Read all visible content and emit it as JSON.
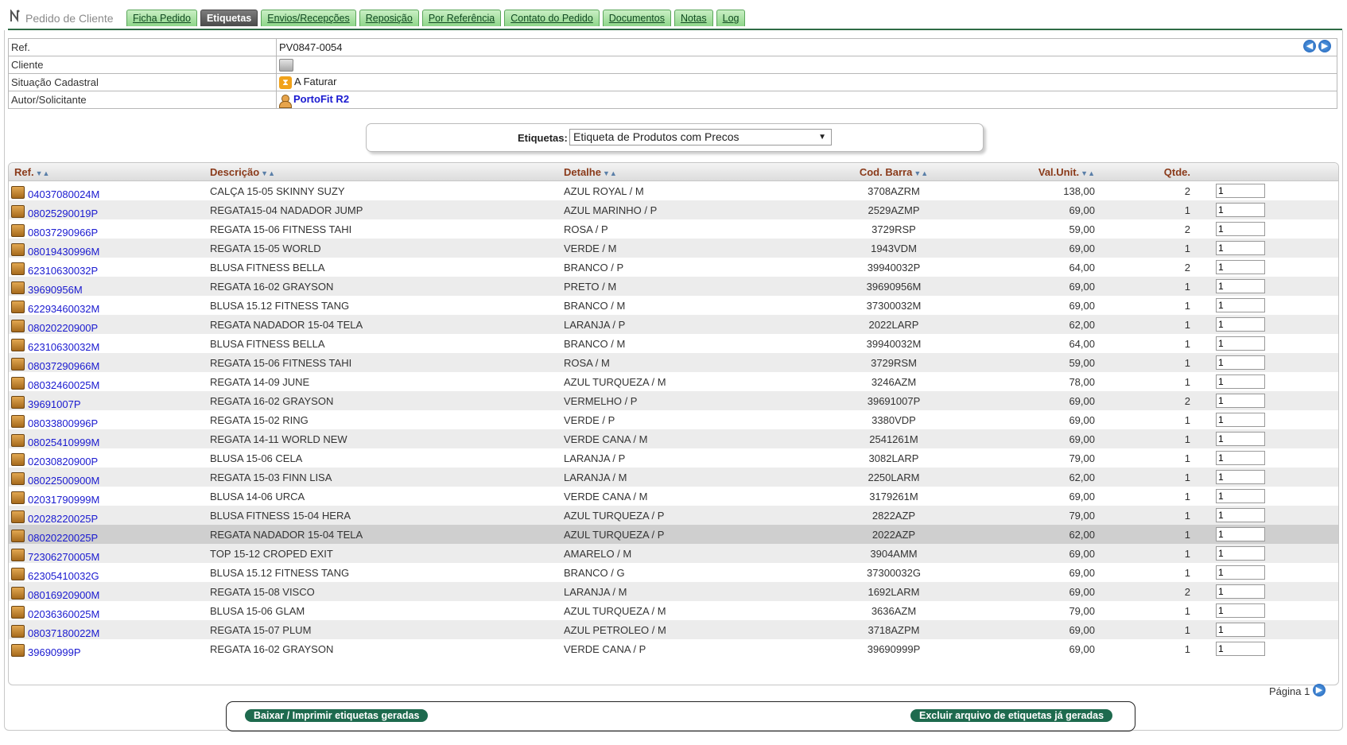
{
  "app": {
    "title": "Pedido de Cliente"
  },
  "tabs": [
    {
      "label": "Ficha Pedido",
      "active": false
    },
    {
      "label": "Etiquetas",
      "active": true
    },
    {
      "label": "Envios/Recepções",
      "active": false
    },
    {
      "label": "Reposição",
      "active": false
    },
    {
      "label": "Por Referência",
      "active": false
    },
    {
      "label": "Contato do Pedido",
      "active": false
    },
    {
      "label": "Documentos",
      "active": false
    },
    {
      "label": "Notas",
      "active": false
    },
    {
      "label": "Log",
      "active": false
    }
  ],
  "info": {
    "ref_label": "Ref.",
    "ref_value": "PV0847-0054",
    "client_label": "Cliente",
    "status_label": "Situação Cadastral",
    "status_value": "A Faturar",
    "author_label": "Autor/Solicitante",
    "author_value": "PortoFit R2"
  },
  "selector": {
    "label": "Etiquetas:",
    "value": "Etiqueta de Produtos com Precos"
  },
  "grid": {
    "headers": {
      "ref": "Ref.",
      "desc": "Descrição",
      "det": "Detalhe",
      "bar": "Cod. Barra",
      "val": "Val.Unit.",
      "qt": "Qtde."
    },
    "rows": [
      {
        "ref": "04037080024M",
        "desc": "CALÇA 15-05 SKINNY SUZY",
        "det": "AZUL ROYAL / M",
        "bar": "3708AZRM",
        "val": "138,00",
        "qt": "2",
        "input": "1"
      },
      {
        "ref": "08025290019P",
        "desc": "REGATA15-04 NADADOR JUMP",
        "det": "AZUL MARINHO / P",
        "bar": "2529AZMP",
        "val": "69,00",
        "qt": "1",
        "input": "1"
      },
      {
        "ref": "08037290966P",
        "desc": "REGATA 15-06 FITNESS TAHI",
        "det": "ROSA / P",
        "bar": "3729RSP",
        "val": "59,00",
        "qt": "2",
        "input": "1"
      },
      {
        "ref": "08019430996M",
        "desc": "REGATA 15-05 WORLD",
        "det": "VERDE / M",
        "bar": "1943VDM",
        "val": "69,00",
        "qt": "1",
        "input": "1"
      },
      {
        "ref": "62310630032P",
        "desc": "BLUSA FITNESS BELLA",
        "det": "BRANCO / P",
        "bar": "39940032P",
        "val": "64,00",
        "qt": "2",
        "input": "1"
      },
      {
        "ref": "39690956M",
        "desc": "REGATA 16-02 GRAYSON",
        "det": "PRETO / M",
        "bar": "39690956M",
        "val": "69,00",
        "qt": "1",
        "input": "1"
      },
      {
        "ref": "62293460032M",
        "desc": "BLUSA 15.12 FITNESS TANG",
        "det": "BRANCO / M",
        "bar": "37300032M",
        "val": "69,00",
        "qt": "1",
        "input": "1"
      },
      {
        "ref": "08020220900P",
        "desc": "REGATA NADADOR 15-04 TELA",
        "det": "LARANJA / P",
        "bar": "2022LARP",
        "val": "62,00",
        "qt": "1",
        "input": "1"
      },
      {
        "ref": "62310630032M",
        "desc": "BLUSA FITNESS BELLA",
        "det": "BRANCO / M",
        "bar": "39940032M",
        "val": "64,00",
        "qt": "1",
        "input": "1"
      },
      {
        "ref": "08037290966M",
        "desc": "REGATA 15-06 FITNESS TAHI",
        "det": "ROSA / M",
        "bar": "3729RSM",
        "val": "59,00",
        "qt": "1",
        "input": "1"
      },
      {
        "ref": "08032460025M",
        "desc": "REGATA 14-09 JUNE",
        "det": "AZUL TURQUEZA / M",
        "bar": "3246AZM",
        "val": "78,00",
        "qt": "1",
        "input": "1"
      },
      {
        "ref": "39691007P",
        "desc": "REGATA 16-02 GRAYSON",
        "det": "VERMELHO / P",
        "bar": "39691007P",
        "val": "69,00",
        "qt": "2",
        "input": "1"
      },
      {
        "ref": "08033800996P",
        "desc": "REGATA 15-02 RING",
        "det": "VERDE / P",
        "bar": "3380VDP",
        "val": "69,00",
        "qt": "1",
        "input": "1"
      },
      {
        "ref": "08025410999M",
        "desc": "REGATA 14-11 WORLD NEW",
        "det": "VERDE CANA / M",
        "bar": "2541261M",
        "val": "69,00",
        "qt": "1",
        "input": "1"
      },
      {
        "ref": "02030820900P",
        "desc": "BLUSA 15-06 CELA",
        "det": "LARANJA / P",
        "bar": "3082LARP",
        "val": "79,00",
        "qt": "1",
        "input": "1"
      },
      {
        "ref": "08022500900M",
        "desc": "REGATA 15-03 FINN LISA",
        "det": "LARANJA / M",
        "bar": "2250LARM",
        "val": "62,00",
        "qt": "1",
        "input": "1"
      },
      {
        "ref": "02031790999M",
        "desc": "BLUSA 14-06 URCA",
        "det": "VERDE CANA / M",
        "bar": "3179261M",
        "val": "69,00",
        "qt": "1",
        "input": "1"
      },
      {
        "ref": "02028220025P",
        "desc": "BLUSA FITNESS 15-04 HERA",
        "det": "AZUL TURQUEZA / P",
        "bar": "2822AZP",
        "val": "79,00",
        "qt": "1",
        "input": "1"
      },
      {
        "ref": "08020220025P",
        "desc": "REGATA NADADOR 15-04 TELA",
        "det": "AZUL TURQUEZA / P",
        "bar": "2022AZP",
        "val": "62,00",
        "qt": "1",
        "input": "1",
        "selected": true
      },
      {
        "ref": "72306270005M",
        "desc": "TOP 15-12 CROPED EXIT",
        "det": "AMARELO / M",
        "bar": "3904AMM",
        "val": "69,00",
        "qt": "1",
        "input": "1"
      },
      {
        "ref": "62305410032G",
        "desc": "BLUSA 15.12 FITNESS TANG",
        "det": "BRANCO / G",
        "bar": "37300032G",
        "val": "69,00",
        "qt": "1",
        "input": "1"
      },
      {
        "ref": "08016920900M",
        "desc": "REGATA 15-08 VISCO",
        "det": "LARANJA / M",
        "bar": "1692LARM",
        "val": "69,00",
        "qt": "2",
        "input": "1"
      },
      {
        "ref": "02036360025M",
        "desc": "BLUSA 15-06 GLAM",
        "det": "AZUL TURQUEZA / M",
        "bar": "3636AZM",
        "val": "79,00",
        "qt": "1",
        "input": "1"
      },
      {
        "ref": "08037180022M",
        "desc": "REGATA 15-07 PLUM",
        "det": "AZUL PETROLEO / M",
        "bar": "3718AZPM",
        "val": "69,00",
        "qt": "1",
        "input": "1"
      },
      {
        "ref": "39690999P",
        "desc": "REGATA 16-02 GRAYSON",
        "det": "VERDE CANA / P",
        "bar": "39690999P",
        "val": "69,00",
        "qt": "1",
        "input": "1"
      }
    ]
  },
  "pager": {
    "label": "Página 1"
  },
  "actions": {
    "print_label": "Baixar / Imprimir etiquetas geradas",
    "delete_label": "Excluir arquivo de etiquetas já geradas"
  },
  "colors": {
    "tab_green": "#8fd68a",
    "tab_active": "#4a4a4a",
    "button": "#1e6a4e",
    "link": "#1a1ad0",
    "header_text": "#8a3a1a"
  }
}
